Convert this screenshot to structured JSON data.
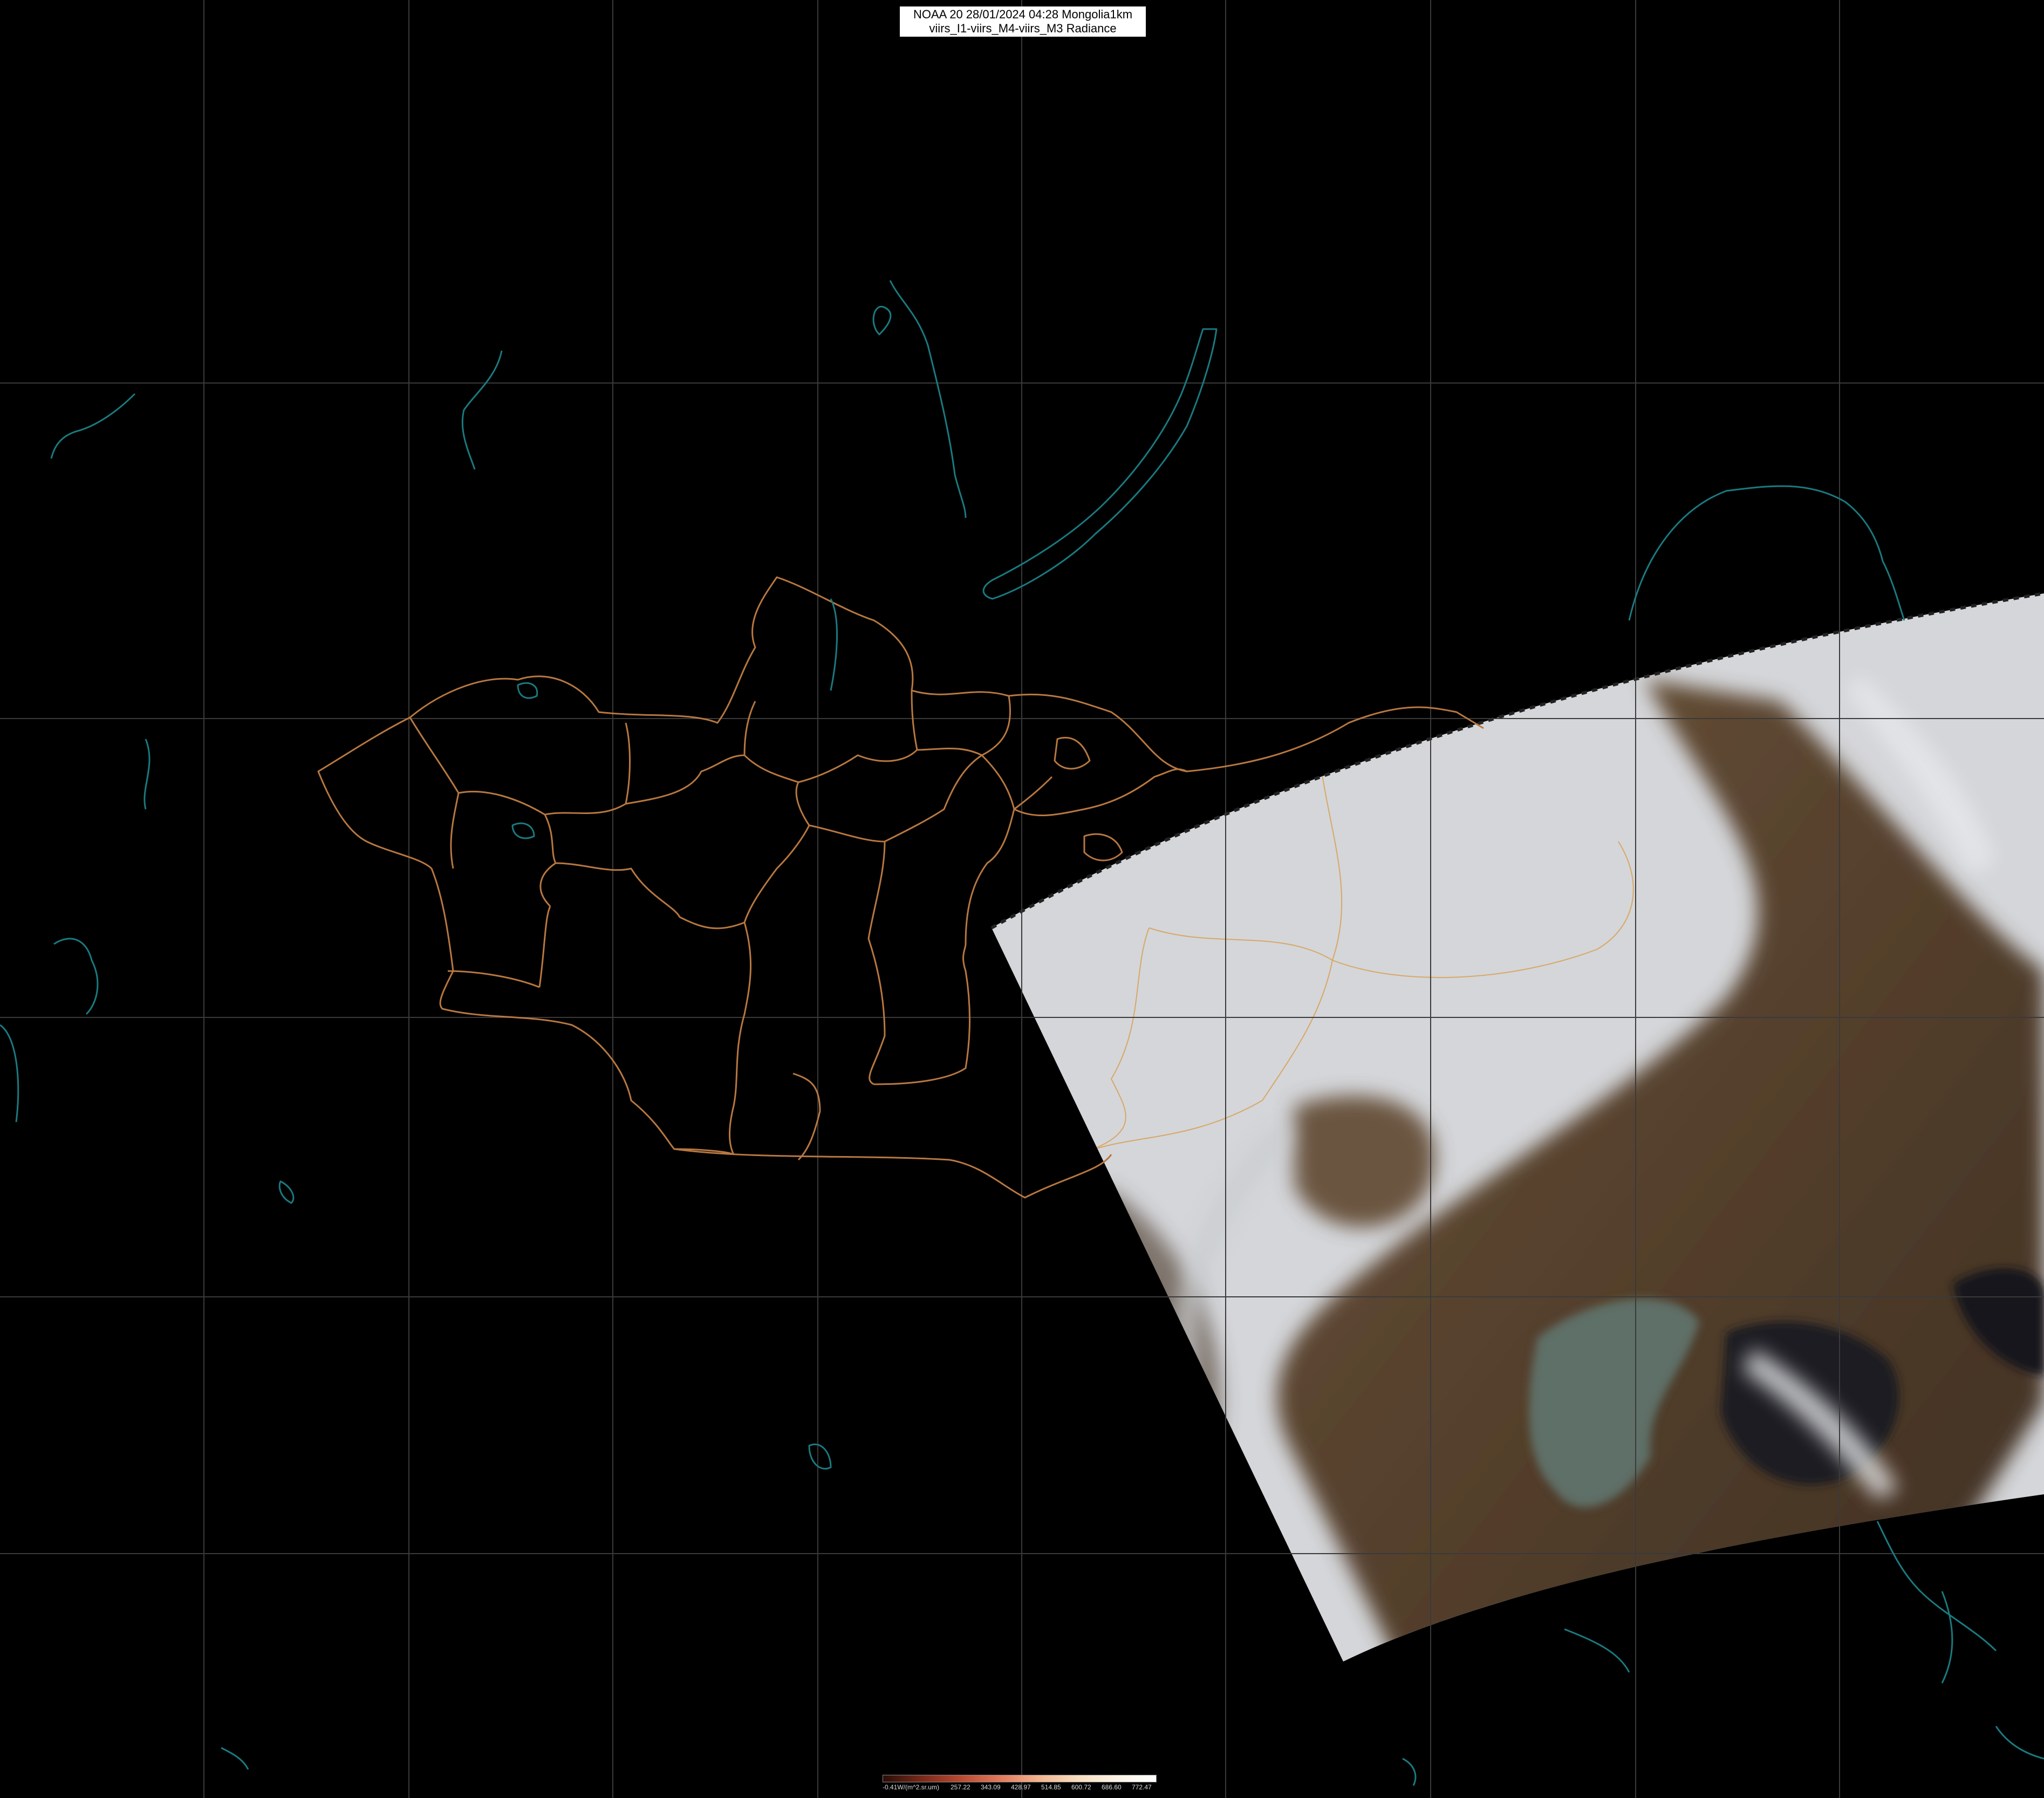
{
  "header": {
    "line1": "NOAA 20 28/01/2024 04:28 Mongolia1km",
    "line2": "viirs_I1-viirs_M4-viirs_M3 Radiance"
  },
  "colorbar": {
    "ticks": [
      "-0.41W/(m^2.sr.um)",
      "257.22",
      "343.09",
      "428.97",
      "514.85",
      "600.72",
      "686.60",
      "772.47"
    ],
    "colors": [
      "#2a0d08",
      "#7a2a1a",
      "#b84a32",
      "#e07a5a",
      "#f2b48e",
      "#f8ddc0",
      "#fdf3e6",
      "#ffffff"
    ]
  },
  "colors": {
    "grid": "#3a3a3a",
    "boundary": "#b87840",
    "water_outline": "#1a7a80",
    "swath_snow": "#d8dadd",
    "swath_land": "#5a4332",
    "swath_sea": "#5f6e66"
  }
}
